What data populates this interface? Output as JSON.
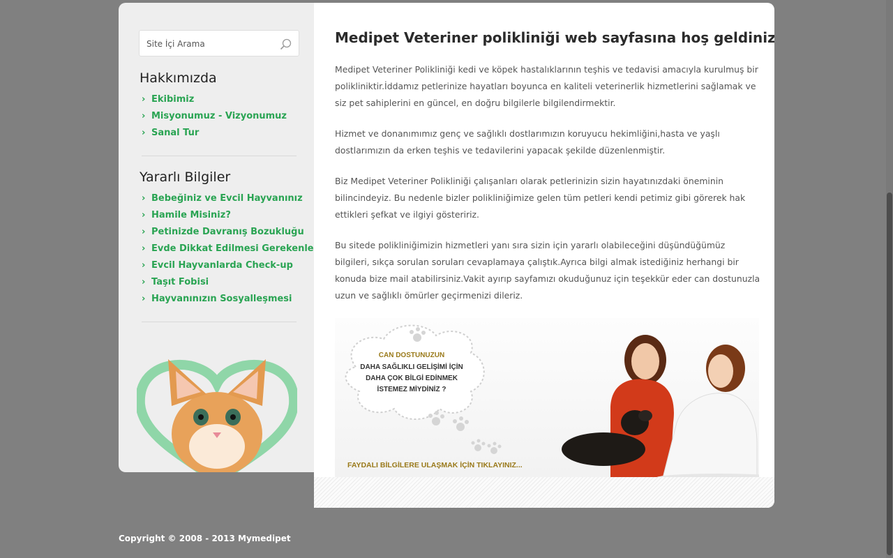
{
  "search": {
    "placeholder": "Site İçi Arama"
  },
  "sidebar": {
    "about_heading": "Hakkımızda",
    "about_items": [
      {
        "label": "Ekibimiz"
      },
      {
        "label": "Misyonumuz - Vizyonumuz"
      },
      {
        "label": "Sanal Tur"
      }
    ],
    "info_heading": "Yararlı Bilgiler",
    "info_items": [
      {
        "label": "Bebeğiniz ve Evcil Hayvanınız"
      },
      {
        "label": "Hamile Misiniz?"
      },
      {
        "label": "Petinizde Davranış Bozukluğu"
      },
      {
        "label": "Evde Dikkat Edilmesi Gerekenler"
      },
      {
        "label": "Evcil Hayvanlarda Check-up"
      },
      {
        "label": "Taşıt Fobisi"
      },
      {
        "label": "Hayvanınızın Sosyalleşmesi"
      }
    ]
  },
  "main": {
    "title": "Medipet Veteriner polikliniği web sayfasına hoş geldiniz!",
    "paragraphs": [
      "Medipet Veteriner Polikliniği kedi ve köpek hastalıklarının teşhis ve tedavisi amacıyla kurulmuş bir polikliniktir.İddamız petlerinize hayatları boyunca en kaliteli veterinerlik hizmetlerini sağlamak ve siz pet sahiplerini en güncel, en doğru bilgilerle bilgilendirmektir.",
      "Hizmet ve donanımımız genç ve sağlıklı dostlarımızın koruyucu hekimliğini,hasta ve yaşlı dostlarımızın da erken teşhis ve tedavilerini yapacak şekilde düzenlenmiştir.",
      "Biz Medipet Veteriner Polikliniği çalışanları olarak petlerinizin sizin hayatınızdaki öneminin bilincindeyiz. Bu nedenle bizler polikliniğimize gelen tüm petleri kendi petimiz gibi görerek hak ettikleri şefkat ve ilgiyi gösteririz.",
      "Bu sitede polikliniğimizin hizmetleri yanı sıra sizin için yararlı olabileceğini düşündüğümüz bilgileri, sıkça sorulan soruları cevaplamaya çalıştık.Ayrıca bilgi almak istediğiniz herhangi bir konuda bize mail atabilirsiniz.Vakit ayırıp sayfamızı okuduğunuz için teşekkür eder can dostunuzla uzun ve sağlıklı ömürler geçirmenizi dileriz."
    ]
  },
  "banner": {
    "cloud_line1": "CAN DOSTUNUZUN",
    "cloud_line2": "DAHA SAĞLIKLI GELİŞİMİ İÇİN",
    "cloud_line3": "DAHA ÇOK BİLGİ EDİNMEK",
    "cloud_line4": "İSTEMEZ MİYDİNİZ ?",
    "link": "FAYDALI BİLGİLERE ULAŞMAK İÇİN TIKLAYINIZ..."
  },
  "footer": {
    "copyright": "Copyright © 2008 - 2013 Mymedipet"
  },
  "colors": {
    "page_bg": "#808080",
    "accent_green": "#2aa453",
    "sidebar_bg": "#eeeeee",
    "banner_link": "#9a7a1a"
  },
  "icons": {
    "search": "magnifier-icon",
    "bullet": "chevron-right-icon"
  }
}
